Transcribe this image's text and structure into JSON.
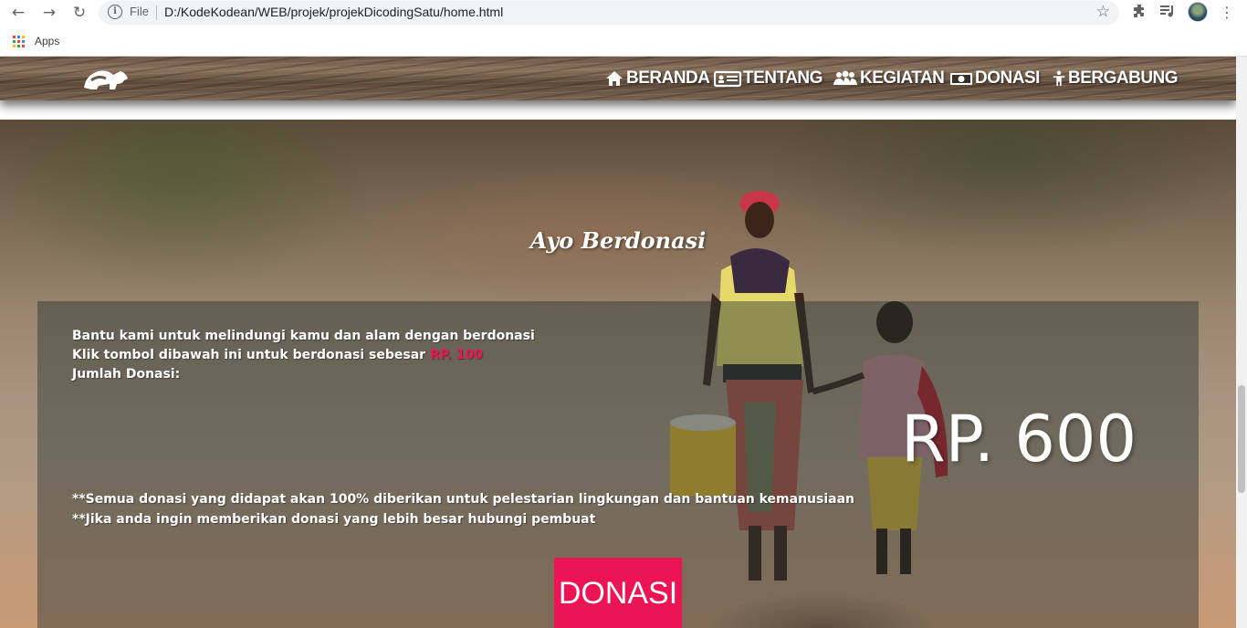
{
  "browser": {
    "url_scheme": "File",
    "url": "D:/KodeKodean/WEB/projek/projekDicodingSatu/home.html",
    "bookmarks_apps_label": "Apps",
    "icons": [
      "back-arrow-icon",
      "forward-arrow-icon",
      "reload-icon",
      "info-icon",
      "star-icon",
      "extensions-puzzle-icon",
      "media-queue-icon",
      "kebab-menu-icon"
    ]
  },
  "navbar": {
    "items": [
      {
        "label": "BERANDA",
        "icon": "home-icon"
      },
      {
        "label": "TENTANG",
        "icon": "id-card-icon"
      },
      {
        "label": "KEGIATAN",
        "icon": "users-icon"
      },
      {
        "label": "DONASI",
        "icon": "money-bill-icon"
      },
      {
        "label": "BERGABUNG",
        "icon": "person-icon"
      }
    ]
  },
  "section": {
    "title": "Ayo Berdonasi",
    "line1": "Bantu kami untuk melindungi kamu dan alam dengan berdonasi",
    "line2_prefix": "Klik tombol dibawah ini untuk berdonasi sebesar ",
    "line2_amount": "RP. 100",
    "line3": "Jumlah Donasi:",
    "total": "RP. 600",
    "note1": "**Semua donasi yang didapat akan 100% diberikan untuk pelestarian lingkungan dan bantuan kemanusiaan",
    "note2": "**Jika anda ingin memberikan donasi yang lebih besar hubungi pembuat",
    "button_label": "DONASI"
  },
  "colors": {
    "accent": "#ec1454",
    "accent_text": "#f0144f",
    "panel_overlay": "rgba(40,50,48,0.45)"
  }
}
